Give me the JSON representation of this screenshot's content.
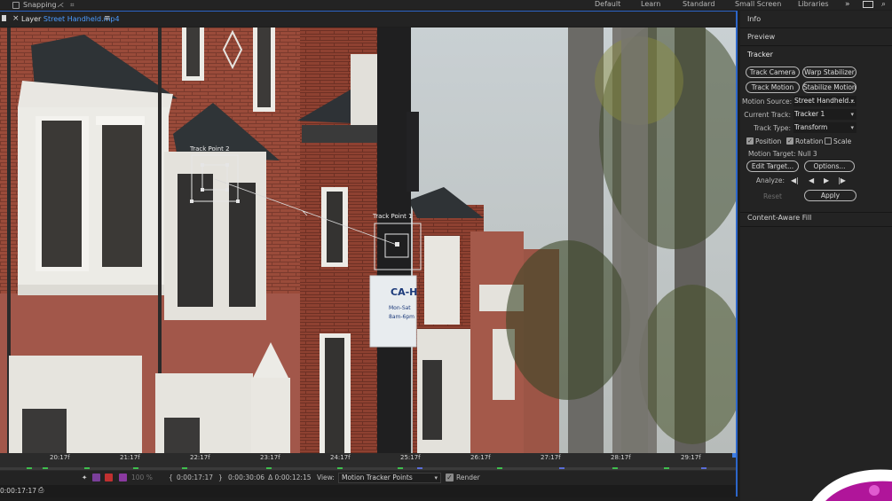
{
  "topbar": {
    "snapping_label": "Snapping",
    "workspaces": [
      "Default",
      "Learn",
      "Standard",
      "Small Screen",
      "Libraries"
    ],
    "more": "»"
  },
  "panel": {
    "prefix": "Layer",
    "filename": "Street Handheld.mp4",
    "menu_icon": "≡"
  },
  "viewer": {
    "track_point_2": "Track Point 2",
    "track_point_1": "Track Point 1",
    "sign_text": [
      "CA-H",
      "Mon-Sat",
      "8am-6pm"
    ]
  },
  "timeline": {
    "ticks": [
      "20:17f",
      "21:17f",
      "22:17f",
      "23:17f",
      "24:17f",
      "25:17f",
      "26:17f",
      "27:17f",
      "28:17f",
      "29:17f"
    ],
    "colors": {
      "keyframe_green": "#3fbf4d",
      "keyframe_blue": "#5a6dd8",
      "accent": "#2d66c9"
    }
  },
  "footer": {
    "zoom": "100 %",
    "current": "0:00:17:17",
    "end": "0:00:30:06",
    "duration": "Δ 0:00:12:15",
    "view_label": "View:",
    "view_value": "Motion Tracker Points",
    "render_label": "Render"
  },
  "status": {
    "time": "0:00:17:17"
  },
  "right_panel": {
    "info": "Info",
    "preview": "Preview",
    "tracker": "Tracker",
    "track_camera": "Track Camera",
    "warp_stabilizer": "Warp Stabilizer",
    "track_motion": "Track Motion",
    "stabilize_motion": "Stabilize Motion",
    "motion_source_label": "Motion Source:",
    "motion_source_value": "Street Handheld...",
    "current_track_label": "Current Track:",
    "current_track_value": "Tracker 1",
    "track_type_label": "Track Type:",
    "track_type_value": "Transform",
    "position": "Position",
    "rotation": "Rotation",
    "scale": "Scale",
    "motion_target": "Motion Target: Null 3",
    "edit_target": "Edit Target...",
    "options": "Options...",
    "analyze_label": "Analyze:",
    "reset": "Reset",
    "apply": "Apply",
    "content_aware_fill": "Content-Aware Fill"
  }
}
